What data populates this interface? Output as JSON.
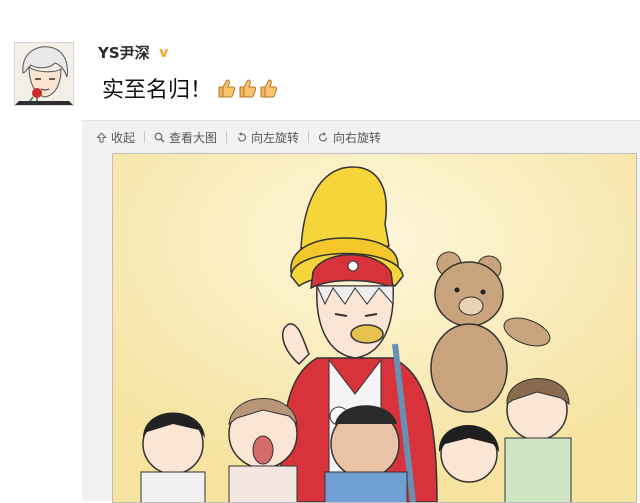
{
  "post": {
    "username": "YS尹深",
    "verified_icon": "v-badge-icon",
    "text": "实至名归！",
    "emoji": [
      "thumbs-up-icon",
      "thumbs-up-icon",
      "thumbs-up-icon"
    ]
  },
  "toolbar": {
    "collapse": "收起",
    "view_large": "查看大图",
    "rotate_left": "向左旋转",
    "rotate_right": "向右旋转"
  },
  "colors": {
    "accent_badge": "#f5a623",
    "picture_bg": "#fbf0c4",
    "hat_yellow": "#f6d53a",
    "jacket_red": "#d8323a"
  }
}
